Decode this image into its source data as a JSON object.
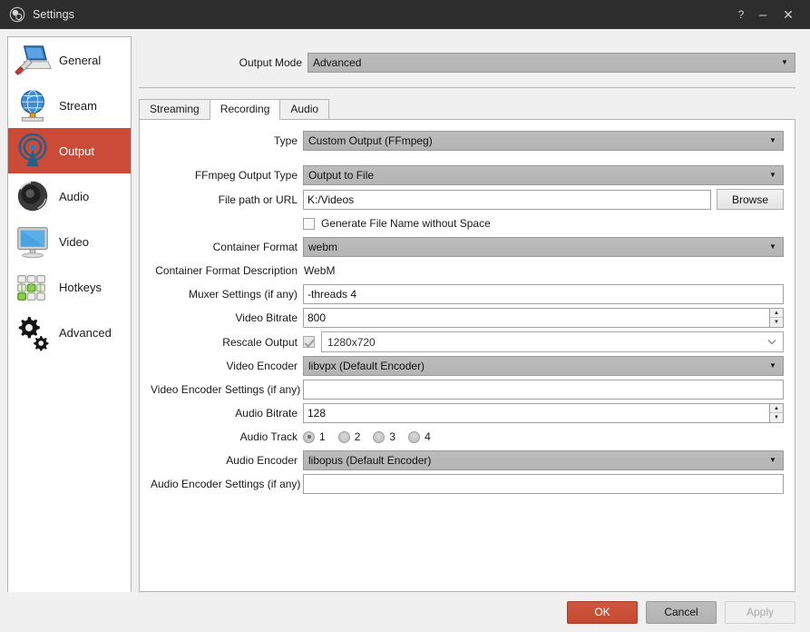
{
  "window": {
    "title": "Settings",
    "icon": "obs-logo-icon",
    "controls": {
      "help": "?",
      "minimize": "–",
      "close": "✕"
    }
  },
  "sidebar": {
    "items": [
      {
        "label": "General",
        "icon": "general-screwdriver-monitor-icon",
        "selected": false
      },
      {
        "label": "Stream",
        "icon": "stream-globe-icon",
        "selected": false
      },
      {
        "label": "Output",
        "icon": "output-broadcast-antenna-icon",
        "selected": true
      },
      {
        "label": "Audio",
        "icon": "audio-speaker-icon",
        "selected": false
      },
      {
        "label": "Video",
        "icon": "video-monitor-icon",
        "selected": false
      },
      {
        "label": "Hotkeys",
        "icon": "hotkeys-keyboard-icon",
        "selected": false
      },
      {
        "label": "Advanced",
        "icon": "advanced-gears-icon",
        "selected": false
      }
    ]
  },
  "output_mode": {
    "label": "Output Mode",
    "value": "Advanced",
    "arrow": "▼"
  },
  "tabs": [
    {
      "label": "Streaming",
      "active": false
    },
    {
      "label": "Recording",
      "active": true
    },
    {
      "label": "Audio",
      "active": false
    }
  ],
  "form": {
    "type": {
      "label": "Type",
      "value": "Custom Output (FFmpeg)"
    },
    "ffmpeg_output_type": {
      "label": "FFmpeg Output Type",
      "value": "Output to File"
    },
    "file_path": {
      "label": "File path or URL",
      "value": "K:/Videos",
      "browse_label": "Browse"
    },
    "generate_no_space": {
      "label": "Generate File Name without Space",
      "checked": false
    },
    "container_format": {
      "label": "Container Format",
      "value": "webm"
    },
    "container_format_description": {
      "label": "Container Format Description",
      "value": "WebM"
    },
    "muxer_settings": {
      "label": "Muxer Settings (if any)",
      "value": "-threads 4"
    },
    "video_bitrate": {
      "label": "Video Bitrate",
      "value": "800"
    },
    "rescale_output": {
      "label": "Rescale Output",
      "checked": true,
      "value": "1280x720"
    },
    "video_encoder": {
      "label": "Video Encoder",
      "value": "libvpx (Default Encoder)"
    },
    "video_encoder_settings": {
      "label": "Video Encoder Settings (if any)",
      "value": ""
    },
    "audio_bitrate": {
      "label": "Audio Bitrate",
      "value": "128"
    },
    "audio_track": {
      "label": "Audio Track",
      "options": [
        "1",
        "2",
        "3",
        "4"
      ],
      "selected": "1"
    },
    "audio_encoder": {
      "label": "Audio Encoder",
      "value": "libopus (Default Encoder)"
    },
    "audio_encoder_settings": {
      "label": "Audio Encoder Settings (if any)",
      "value": ""
    }
  },
  "footer": {
    "ok": "OK",
    "cancel": "Cancel",
    "apply": "Apply"
  },
  "glyphs": {
    "arrow_down_filled": "▼",
    "spin_up": "▲",
    "spin_down": "▼"
  },
  "colors": {
    "accent_red": "#cc4a38",
    "titlebar": "#2d2d2d",
    "dialog_bg": "#f0f0f0",
    "panel_bg": "#ffffff",
    "combo_gray": "#b7b7b7"
  }
}
